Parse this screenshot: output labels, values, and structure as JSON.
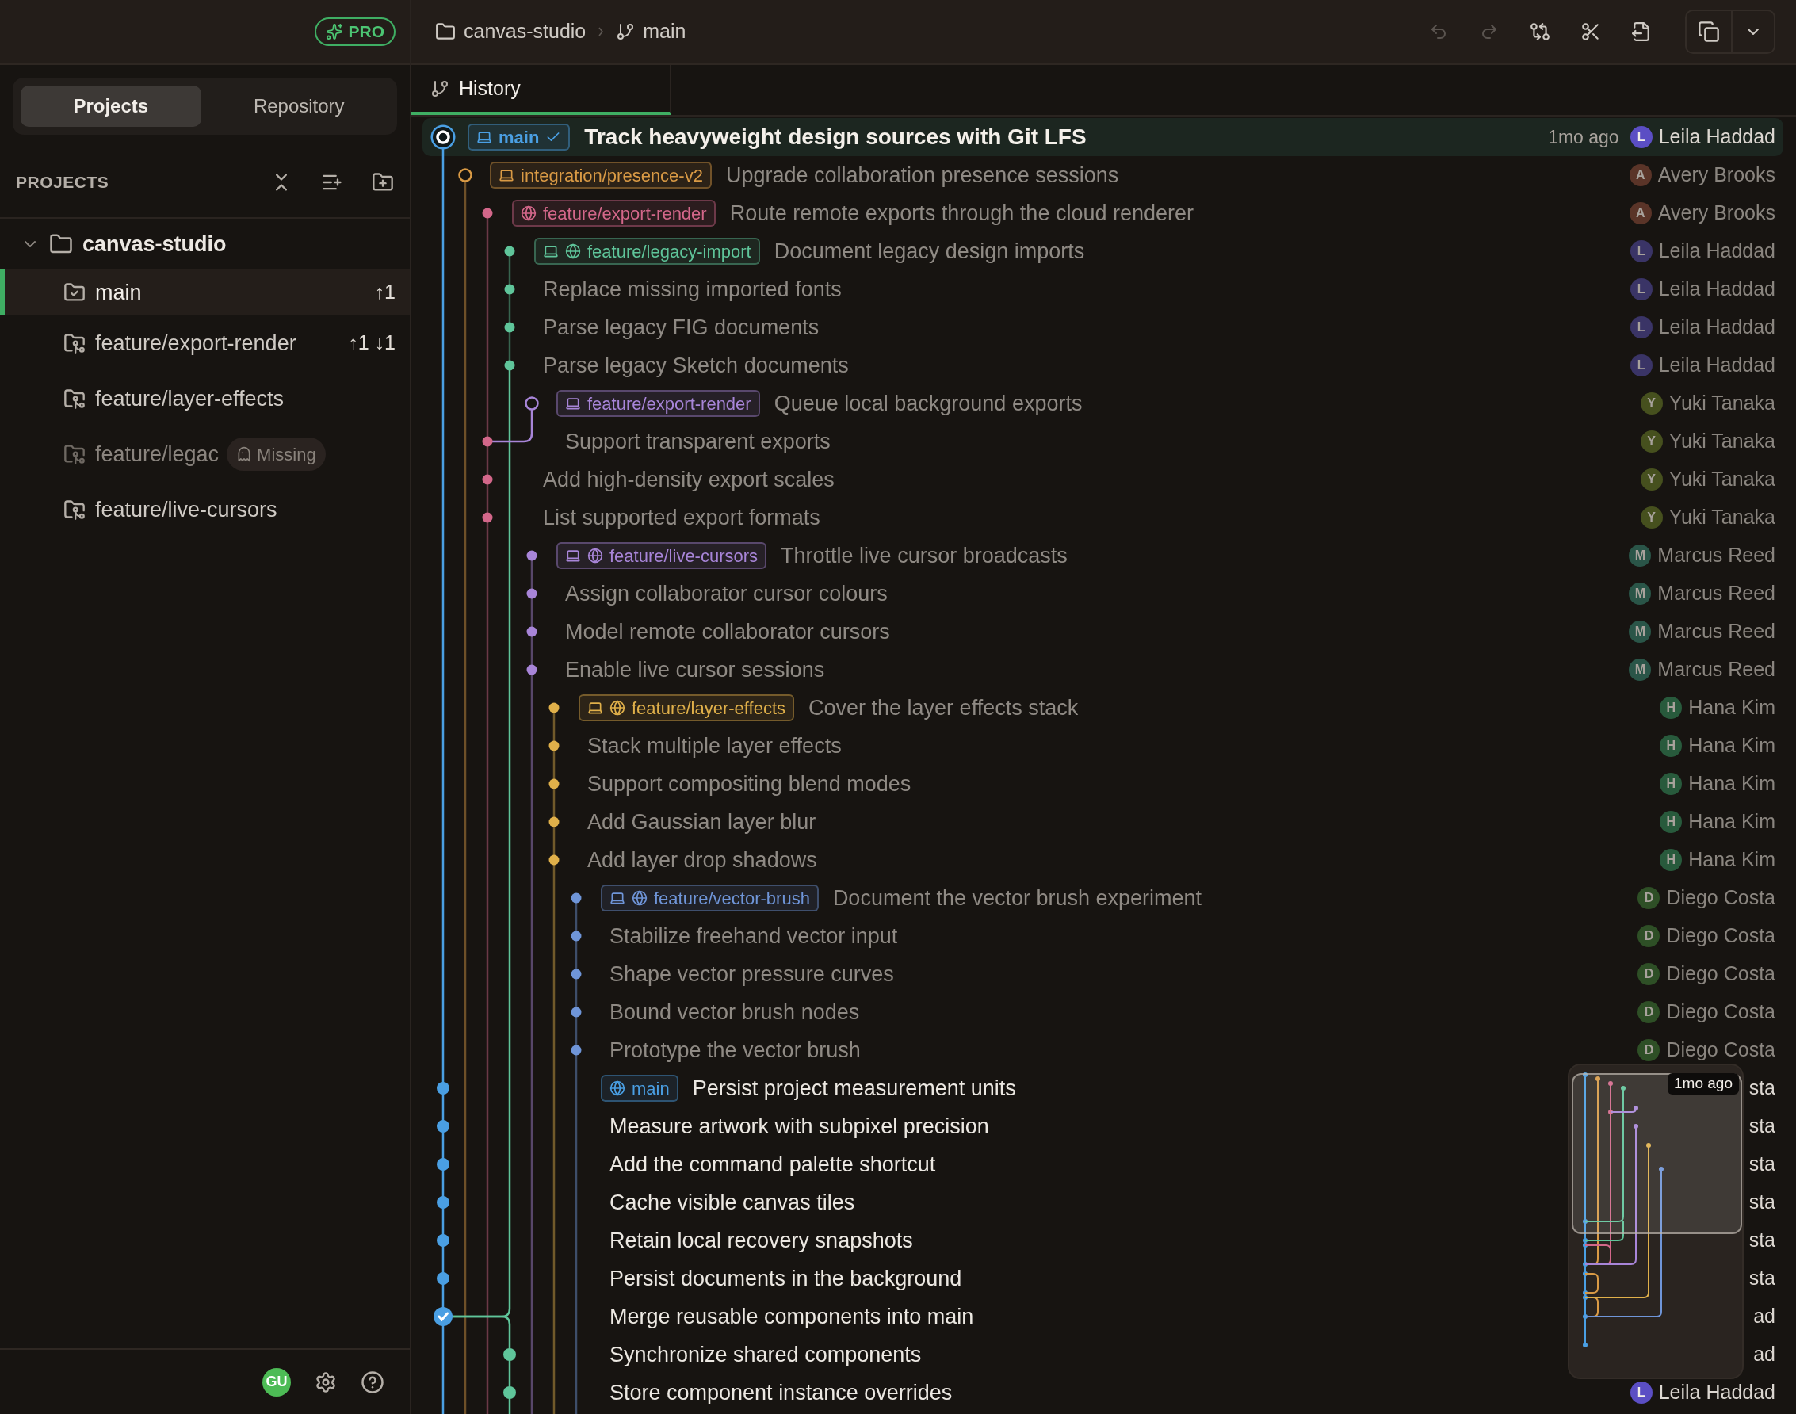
{
  "sidebar": {
    "badge": "PRO",
    "tabs": [
      {
        "label": "Projects",
        "selected": true
      },
      {
        "label": "Repository",
        "selected": false
      }
    ],
    "section_title": "PROJECTS",
    "project": {
      "name": "canvas-studio",
      "expanded": true,
      "worktrees": [
        {
          "kind": "main",
          "label": "main",
          "selected": true,
          "missing": false,
          "counts": "↑1"
        },
        {
          "kind": "worktree",
          "label": "feature/export-render",
          "selected": false,
          "missing": false,
          "counts": "↑1 ↓1"
        },
        {
          "kind": "worktree",
          "label": "feature/layer-effects",
          "selected": false,
          "missing": false
        },
        {
          "kind": "worktree",
          "label": "feature/legac",
          "selected": false,
          "missing": true,
          "badge": "Missing"
        },
        {
          "kind": "worktree",
          "label": "feature/live-cursors",
          "selected": false,
          "missing": false
        }
      ]
    },
    "footer": {
      "avatar": "GU"
    }
  },
  "toolbar": {
    "breadcrumb": [
      {
        "kind": "folder",
        "label": "canvas-studio"
      },
      {
        "kind": "branch",
        "label": "main"
      }
    ],
    "actions": [
      {
        "kind": "undo",
        "disabled": true
      },
      {
        "kind": "redo",
        "disabled": true
      },
      {
        "kind": "compare",
        "disabled": false
      },
      {
        "kind": "cut",
        "disabled": false
      },
      {
        "kind": "export",
        "disabled": false
      }
    ],
    "split_button": [
      {
        "kind": "copy"
      },
      {
        "kind": "dropdown"
      }
    ]
  },
  "tabs": [
    {
      "label": "History",
      "selected": true
    }
  ],
  "commits": [
    {
      "message": "Track heavyweight design sources with Git LFS",
      "color": "#4a9fe3",
      "selected": true,
      "dimmed": false,
      "hollow": false,
      "check": false,
      "ref": {
        "name": "main",
        "local": true,
        "remote": false,
        "current": true
      },
      "time": "1mo ago",
      "author": "Leila Haddad",
      "avatar": {
        "initial": "L",
        "color": "#5b4ec4"
      }
    },
    {
      "message": "Upgrade collaboration presence sessions",
      "color": "#d99a45",
      "selected": false,
      "dimmed": true,
      "hollow": true,
      "check": false,
      "ref": {
        "name": "integration/presence-v2",
        "local": true,
        "remote": false,
        "current": false
      },
      "author": "Avery Brooks",
      "avatar": {
        "initial": "A",
        "color": "#5a3428"
      }
    },
    {
      "message": "Route remote exports through the cloud renderer",
      "color": "#d3678a",
      "selected": false,
      "dimmed": true,
      "hollow": false,
      "check": false,
      "ref": {
        "name": "feature/export-render",
        "local": false,
        "remote": true,
        "current": false
      },
      "author": "Avery Brooks",
      "avatar": {
        "initial": "A",
        "color": "#5a3428"
      }
    },
    {
      "message": "Document legacy design imports",
      "color": "#5fc59a",
      "selected": false,
      "dimmed": true,
      "hollow": false,
      "check": false,
      "ref": {
        "name": "feature/legacy-import",
        "local": true,
        "remote": true,
        "current": false
      },
      "author": "Leila Haddad",
      "avatar": {
        "initial": "L",
        "color": "#3a3466"
      }
    },
    {
      "message": "Replace missing imported fonts",
      "color": "#5fc59a",
      "selected": false,
      "dimmed": true,
      "hollow": false,
      "check": false,
      "author": "Leila Haddad",
      "avatar": {
        "initial": "L",
        "color": "#3a3466"
      }
    },
    {
      "message": "Parse legacy FIG documents",
      "color": "#5fc59a",
      "selected": false,
      "dimmed": true,
      "hollow": false,
      "check": false,
      "author": "Leila Haddad",
      "avatar": {
        "initial": "L",
        "color": "#3a3466"
      }
    },
    {
      "message": "Parse legacy Sketch documents",
      "color": "#5fc59a",
      "selected": false,
      "dimmed": true,
      "hollow": false,
      "check": false,
      "author": "Leila Haddad",
      "avatar": {
        "initial": "L",
        "color": "#3a3466"
      }
    },
    {
      "message": "Queue local background exports",
      "color": "#a885d8",
      "selected": false,
      "dimmed": true,
      "hollow": true,
      "check": false,
      "ref": {
        "name": "feature/export-render",
        "local": true,
        "remote": false,
        "current": false
      },
      "author": "Yuki Tanaka",
      "avatar": {
        "initial": "Y",
        "color": "#46501e"
      }
    },
    {
      "message": "Support transparent exports",
      "color": "#d3678a",
      "merge": {
        "color": "#a885d8"
      },
      "selected": false,
      "dimmed": true,
      "hollow": false,
      "check": false,
      "author": "Yuki Tanaka",
      "avatar": {
        "initial": "Y",
        "color": "#46501e"
      }
    },
    {
      "message": "Add high-density export scales",
      "color": "#d3678a",
      "selected": false,
      "dimmed": true,
      "hollow": false,
      "check": false,
      "author": "Yuki Tanaka",
      "avatar": {
        "initial": "Y",
        "color": "#46501e"
      }
    },
    {
      "message": "List supported export formats",
      "color": "#d3678a",
      "selected": false,
      "dimmed": true,
      "hollow": false,
      "check": false,
      "author": "Yuki Tanaka",
      "avatar": {
        "initial": "Y",
        "color": "#46501e"
      }
    },
    {
      "message": "Throttle live cursor broadcasts",
      "color": "#a885d8",
      "selected": false,
      "dimmed": true,
      "hollow": false,
      "check": false,
      "ref": {
        "name": "feature/live-cursors",
        "local": true,
        "remote": true,
        "current": false
      },
      "author": "Marcus Reed",
      "avatar": {
        "initial": "M",
        "color": "#2a5548"
      }
    },
    {
      "message": "Assign collaborator cursor colours",
      "color": "#a885d8",
      "selected": false,
      "dimmed": true,
      "hollow": false,
      "check": false,
      "author": "Marcus Reed",
      "avatar": {
        "initial": "M",
        "color": "#2a5548"
      }
    },
    {
      "message": "Model remote collaborator cursors",
      "color": "#a885d8",
      "selected": false,
      "dimmed": true,
      "hollow": false,
      "check": false,
      "author": "Marcus Reed",
      "avatar": {
        "initial": "M",
        "color": "#2a5548"
      }
    },
    {
      "message": "Enable live cursor sessions",
      "color": "#a885d8",
      "selected": false,
      "dimmed": true,
      "hollow": false,
      "check": false,
      "author": "Marcus Reed",
      "avatar": {
        "initial": "M",
        "color": "#2a5548"
      }
    },
    {
      "message": "Cover the layer effects stack",
      "color": "#e0b04a",
      "selected": false,
      "dimmed": true,
      "hollow": false,
      "check": false,
      "ref": {
        "name": "feature/layer-effects",
        "local": true,
        "remote": true,
        "current": false
      },
      "author": "Hana Kim",
      "avatar": {
        "initial": "H",
        "color": "#285a3c"
      }
    },
    {
      "message": "Stack multiple layer effects",
      "color": "#e0b04a",
      "selected": false,
      "dimmed": true,
      "hollow": false,
      "check": false,
      "author": "Hana Kim",
      "avatar": {
        "initial": "H",
        "color": "#285a3c"
      }
    },
    {
      "message": "Support compositing blend modes",
      "color": "#e0b04a",
      "selected": false,
      "dimmed": true,
      "hollow": false,
      "check": false,
      "author": "Hana Kim",
      "avatar": {
        "initial": "H",
        "color": "#285a3c"
      }
    },
    {
      "message": "Add Gaussian layer blur",
      "color": "#e0b04a",
      "selected": false,
      "dimmed": true,
      "hollow": false,
      "check": false,
      "author": "Hana Kim",
      "avatar": {
        "initial": "H",
        "color": "#285a3c"
      }
    },
    {
      "message": "Add layer drop shadows",
      "color": "#e0b04a",
      "selected": false,
      "dimmed": true,
      "hollow": false,
      "check": false,
      "author": "Hana Kim",
      "avatar": {
        "initial": "H",
        "color": "#285a3c"
      }
    },
    {
      "message": "Document the vector brush experiment",
      "color": "#6f95d8",
      "selected": false,
      "dimmed": true,
      "hollow": false,
      "check": false,
      "ref": {
        "name": "feature/vector-brush",
        "local": true,
        "remote": true,
        "current": false
      },
      "author": "Diego Costa",
      "avatar": {
        "initial": "D",
        "color": "#2e4f26"
      }
    },
    {
      "message": "Stabilize freehand vector input",
      "color": "#6f95d8",
      "selected": false,
      "dimmed": true,
      "hollow": false,
      "check": false,
      "author": "Diego Costa",
      "avatar": {
        "initial": "D",
        "color": "#2e4f26"
      }
    },
    {
      "message": "Shape vector pressure curves",
      "color": "#6f95d8",
      "selected": false,
      "dimmed": true,
      "hollow": false,
      "check": false,
      "author": "Diego Costa",
      "avatar": {
        "initial": "D",
        "color": "#2e4f26"
      }
    },
    {
      "message": "Bound vector brush nodes",
      "color": "#6f95d8",
      "selected": false,
      "dimmed": true,
      "hollow": false,
      "check": false,
      "author": "Diego Costa",
      "avatar": {
        "initial": "D",
        "color": "#2e4f26"
      }
    },
    {
      "message": "Prototype the vector brush",
      "color": "#6f95d8",
      "selected": false,
      "dimmed": true,
      "hollow": false,
      "check": false,
      "author": "Diego Costa",
      "avatar": {
        "initial": "D",
        "color": "#2e4f26"
      }
    },
    {
      "message": "Persist project measurement units",
      "color": "#4a9fe3",
      "selected": false,
      "dimmed": false,
      "hollow": false,
      "check": false,
      "ref": {
        "name": "main",
        "local": false,
        "remote": true,
        "current": false
      },
      "author": "sta"
    },
    {
      "message": "Measure artwork with subpixel precision",
      "color": "#4a9fe3",
      "selected": false,
      "dimmed": false,
      "hollow": false,
      "check": false,
      "author": "sta"
    },
    {
      "message": "Add the command palette shortcut",
      "color": "#4a9fe3",
      "selected": false,
      "dimmed": false,
      "hollow": false,
      "check": false,
      "author": "sta"
    },
    {
      "message": "Cache visible canvas tiles",
      "color": "#4a9fe3",
      "selected": false,
      "dimmed": false,
      "hollow": false,
      "check": false,
      "author": "sta"
    },
    {
      "message": "Retain local recovery snapshots",
      "color": "#4a9fe3",
      "selected": false,
      "dimmed": false,
      "hollow": false,
      "check": false,
      "author": "sta"
    },
    {
      "message": "Persist documents in the background",
      "color": "#4a9fe3",
      "selected": false,
      "dimmed": false,
      "hollow": false,
      "check": false,
      "author": "sta"
    },
    {
      "message": "Merge reusable components into main",
      "color": "#4a9fe3",
      "merge": {
        "color": "#5fc59a"
      },
      "selected": false,
      "dimmed": false,
      "hollow": false,
      "check": true,
      "author": "ad"
    },
    {
      "message": "Synchronize shared components",
      "color": "#5fc59a",
      "selected": false,
      "dimmed": false,
      "hollow": false,
      "check": false,
      "author": "ad"
    },
    {
      "message": "Store component instance overrides",
      "color": "#5fc59a",
      "selected": false,
      "dimmed": false,
      "hollow": false,
      "check": false,
      "author": "Leila Haddad",
      "avatar": {
        "initial": "L",
        "color": "#5b4ec4"
      }
    }
  ],
  "minimap": {
    "tooltip": "1mo ago"
  }
}
